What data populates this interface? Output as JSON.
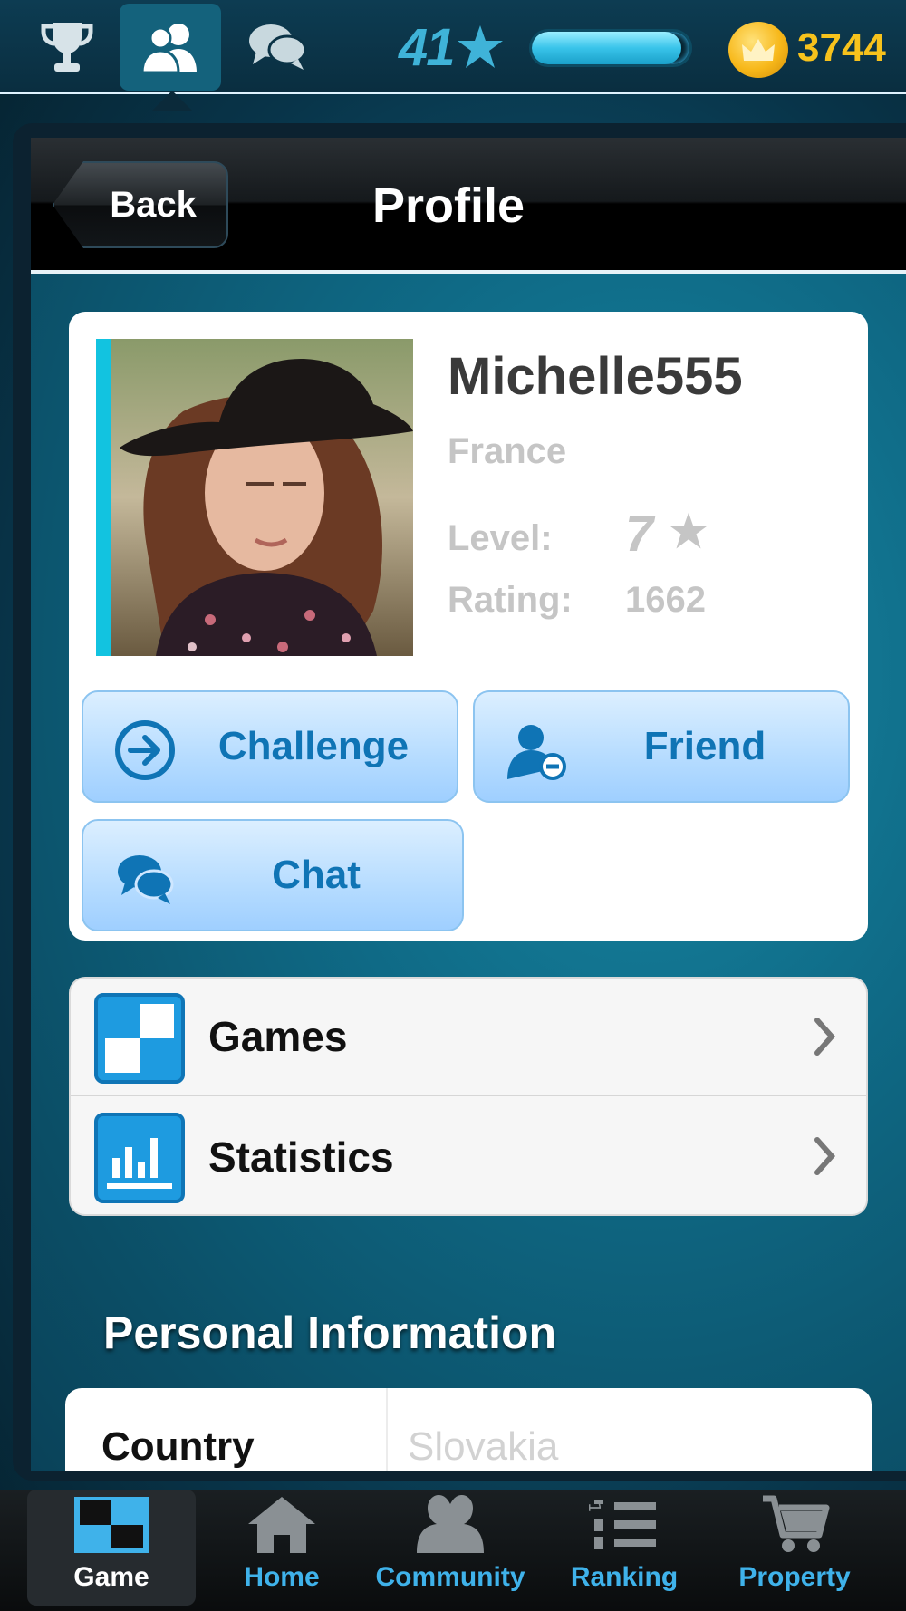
{
  "topbar": {
    "level": "41",
    "xp_fraction": 0.95,
    "coins": "3744"
  },
  "navbar": {
    "back_label": "Back",
    "title": "Profile"
  },
  "profile": {
    "username": "Michelle555",
    "country": "France",
    "level_label": "Level:",
    "level_value": "7",
    "rating_label": "Rating:",
    "rating_value": "1662"
  },
  "actions": {
    "challenge": "Challenge",
    "friend": "Friend",
    "chat": "Chat"
  },
  "list": {
    "games": "Games",
    "statistics": "Statistics"
  },
  "personal": {
    "title": "Personal Information",
    "country_label": "Country",
    "country_value": "Slovakia"
  },
  "tabs": {
    "game": "Game",
    "home": "Home",
    "community": "Community",
    "ranking": "Ranking",
    "property": "Property"
  },
  "colors": {
    "accent": "#3fb2ea",
    "coin": "#f7c21c",
    "button_text": "#0f74b5",
    "avatar_strip": "#12c3e0"
  }
}
